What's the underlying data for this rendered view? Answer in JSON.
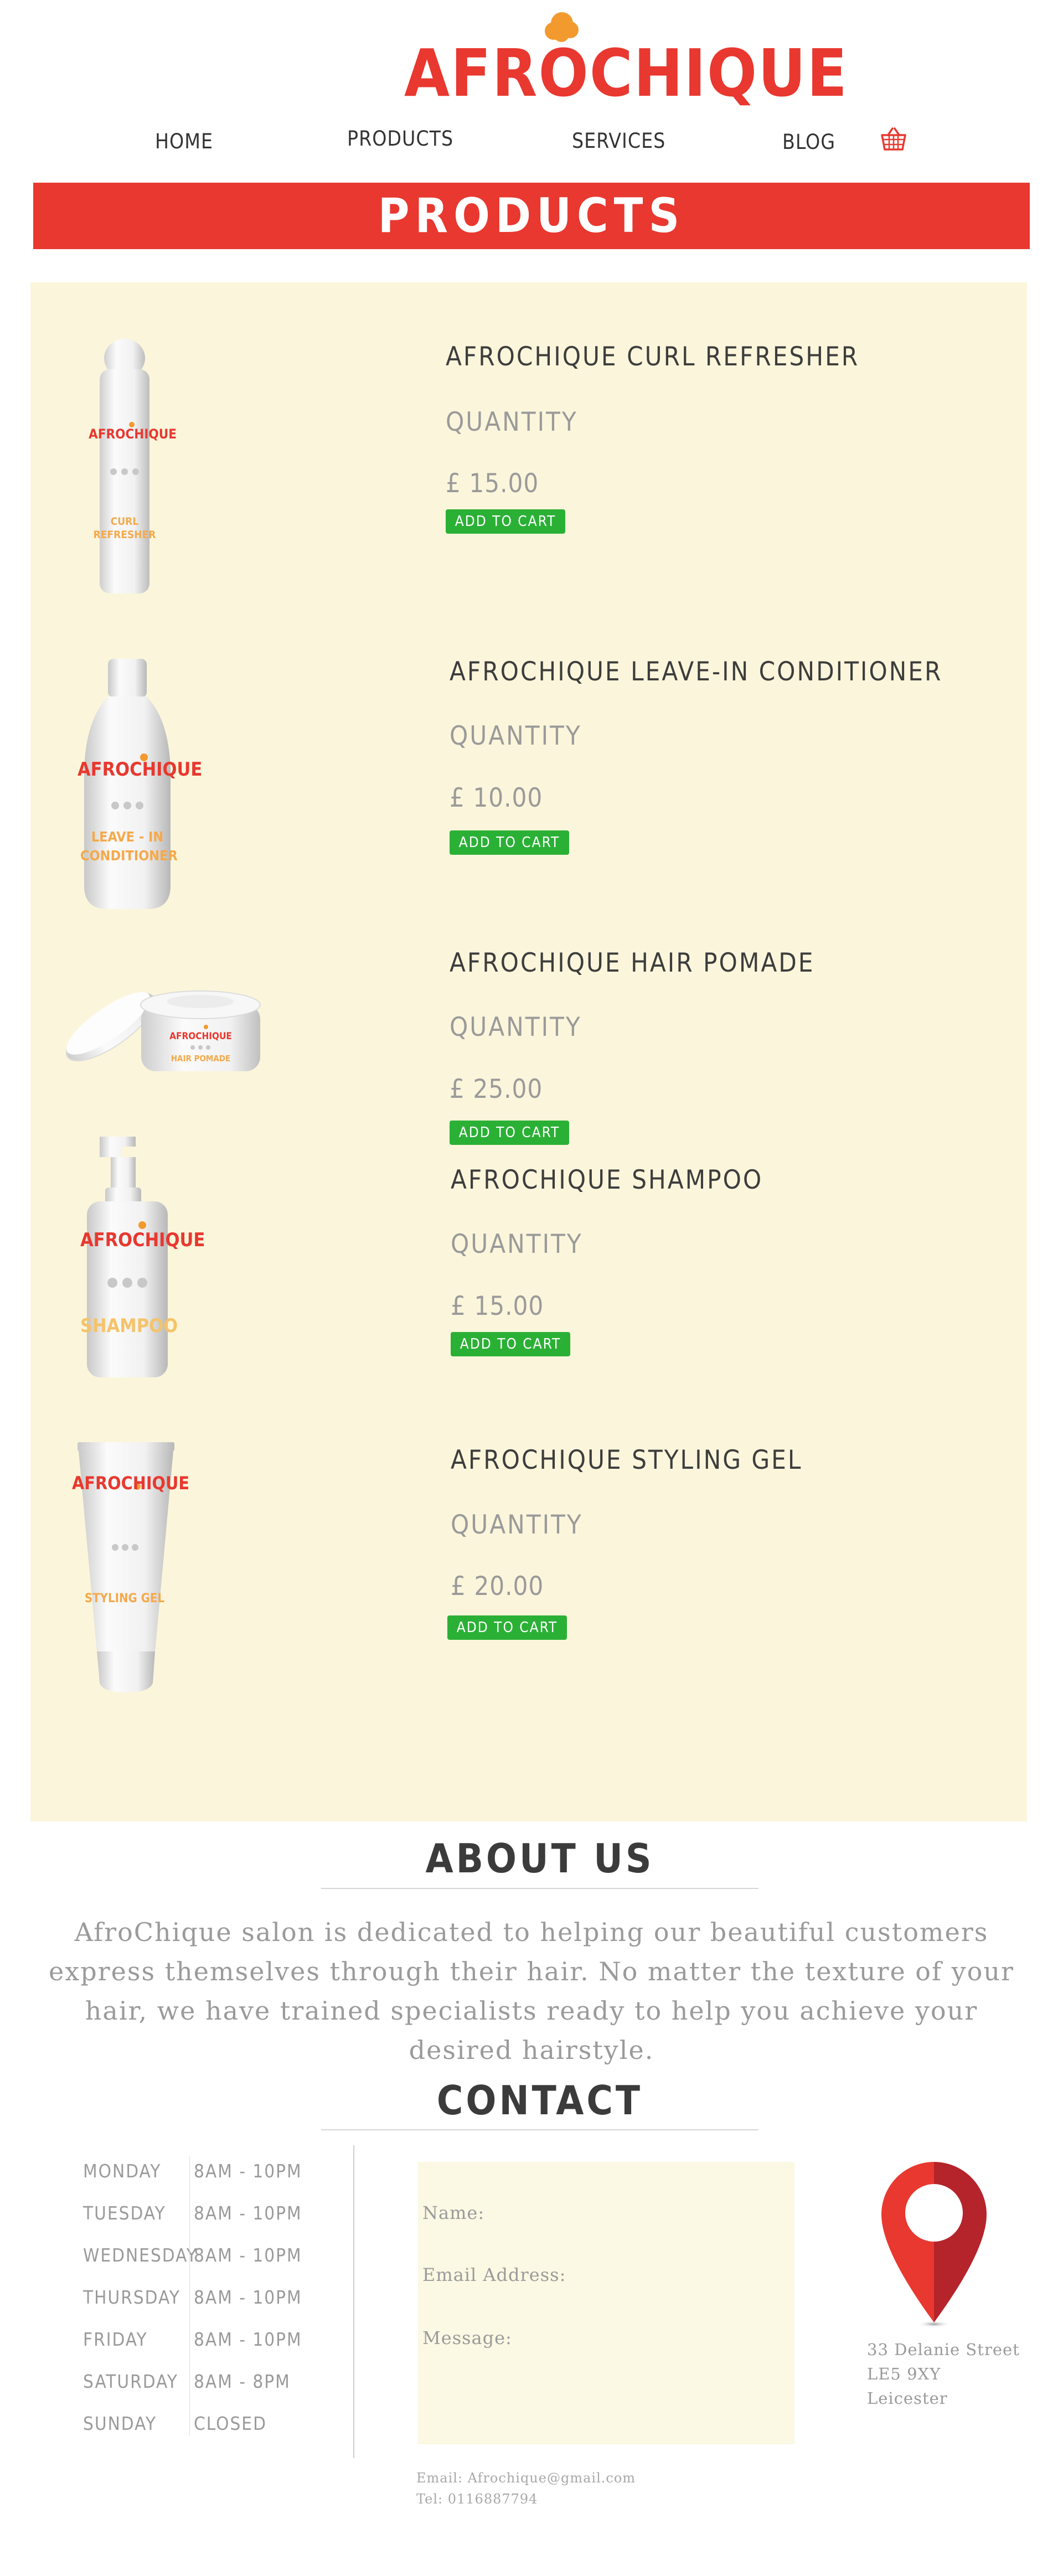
{
  "header": {
    "logo_text": "AFROCHIQUE",
    "nav": [
      {
        "label": "HOME"
      },
      {
        "label": "PRODUCTS"
      },
      {
        "label": "SERVICES"
      },
      {
        "label": "BLOG"
      }
    ],
    "cart_icon": "basket-icon"
  },
  "banner": {
    "title": "PRODUCTS"
  },
  "products": [
    {
      "name": "AFROCHIQUE CURL REFRESHER",
      "quantity_label": "QUANTITY",
      "price": "£ 15.00",
      "button": "ADD TO CART",
      "image_label_brand": "AFROCHIQUE",
      "image_label_product": "CURL REFRESHER"
    },
    {
      "name": "AFROCHIQUE LEAVE-IN CONDITIONER",
      "quantity_label": "QUANTITY",
      "price": "£ 10.00",
      "button": "ADD TO CART",
      "image_label_brand": "AFROCHIQUE",
      "image_label_product": "LEAVE - IN CONDITIONER"
    },
    {
      "name": "AFROCHIQUE HAIR POMADE",
      "quantity_label": "QUANTITY",
      "price": "£ 25.00",
      "button": "ADD TO CART",
      "image_label_brand": "AFROCHIQUE",
      "image_label_product": "HAIR POMADE"
    },
    {
      "name": "AFROCHIQUE SHAMPOO",
      "quantity_label": "QUANTITY",
      "price": "£ 15.00",
      "button": "ADD TO CART",
      "image_label_brand": "AFROCHIQUE",
      "image_label_product": "SHAMPOO"
    },
    {
      "name": "AFROCHIQUE STYLING GEL",
      "quantity_label": "QUANTITY",
      "price": "£ 20.00",
      "button": "ADD TO CART",
      "image_label_brand": "AFROCHIQUE",
      "image_label_product": "STYLING GEL"
    }
  ],
  "about": {
    "title": "ABOUT US",
    "text": "AfroChique salon is dedicated to helping our beautiful customers express themselves through their hair. No matter the texture of your hair,  we have trained specialists ready to help you achieve your desired hairstyle."
  },
  "contact": {
    "title": "CONTACT",
    "hours": [
      {
        "day": "MONDAY",
        "time": "8AM - 10PM"
      },
      {
        "day": "TUESDAY",
        "time": "8AM - 10PM"
      },
      {
        "day": "WEDNESDAY",
        "time": "8AM - 10PM"
      },
      {
        "day": "THURSDAY",
        "time": "8AM - 10PM"
      },
      {
        "day": "FRIDAY",
        "time": "8AM - 10PM"
      },
      {
        "day": "SATURDAY",
        "time": "8AM - 8PM"
      },
      {
        "day": "SUNDAY",
        "time": "CLOSED"
      }
    ],
    "form": {
      "name_label": "Name:",
      "email_label": "Email Address:",
      "message_label": "Message:"
    },
    "address": {
      "line1": "33 Delanie Street",
      "line2": "LE5 9XY",
      "line3": "Leicester"
    },
    "email": "Email: Afrochique@gmail.com",
    "tel": "Tel: 0116887794",
    "map_icon": "map-pin-icon"
  },
  "colors": {
    "brand_red": "#e8382f",
    "logo_orange": "#f29a2e",
    "panel_bg": "#fbf6db",
    "button_green": "#2bb036"
  }
}
